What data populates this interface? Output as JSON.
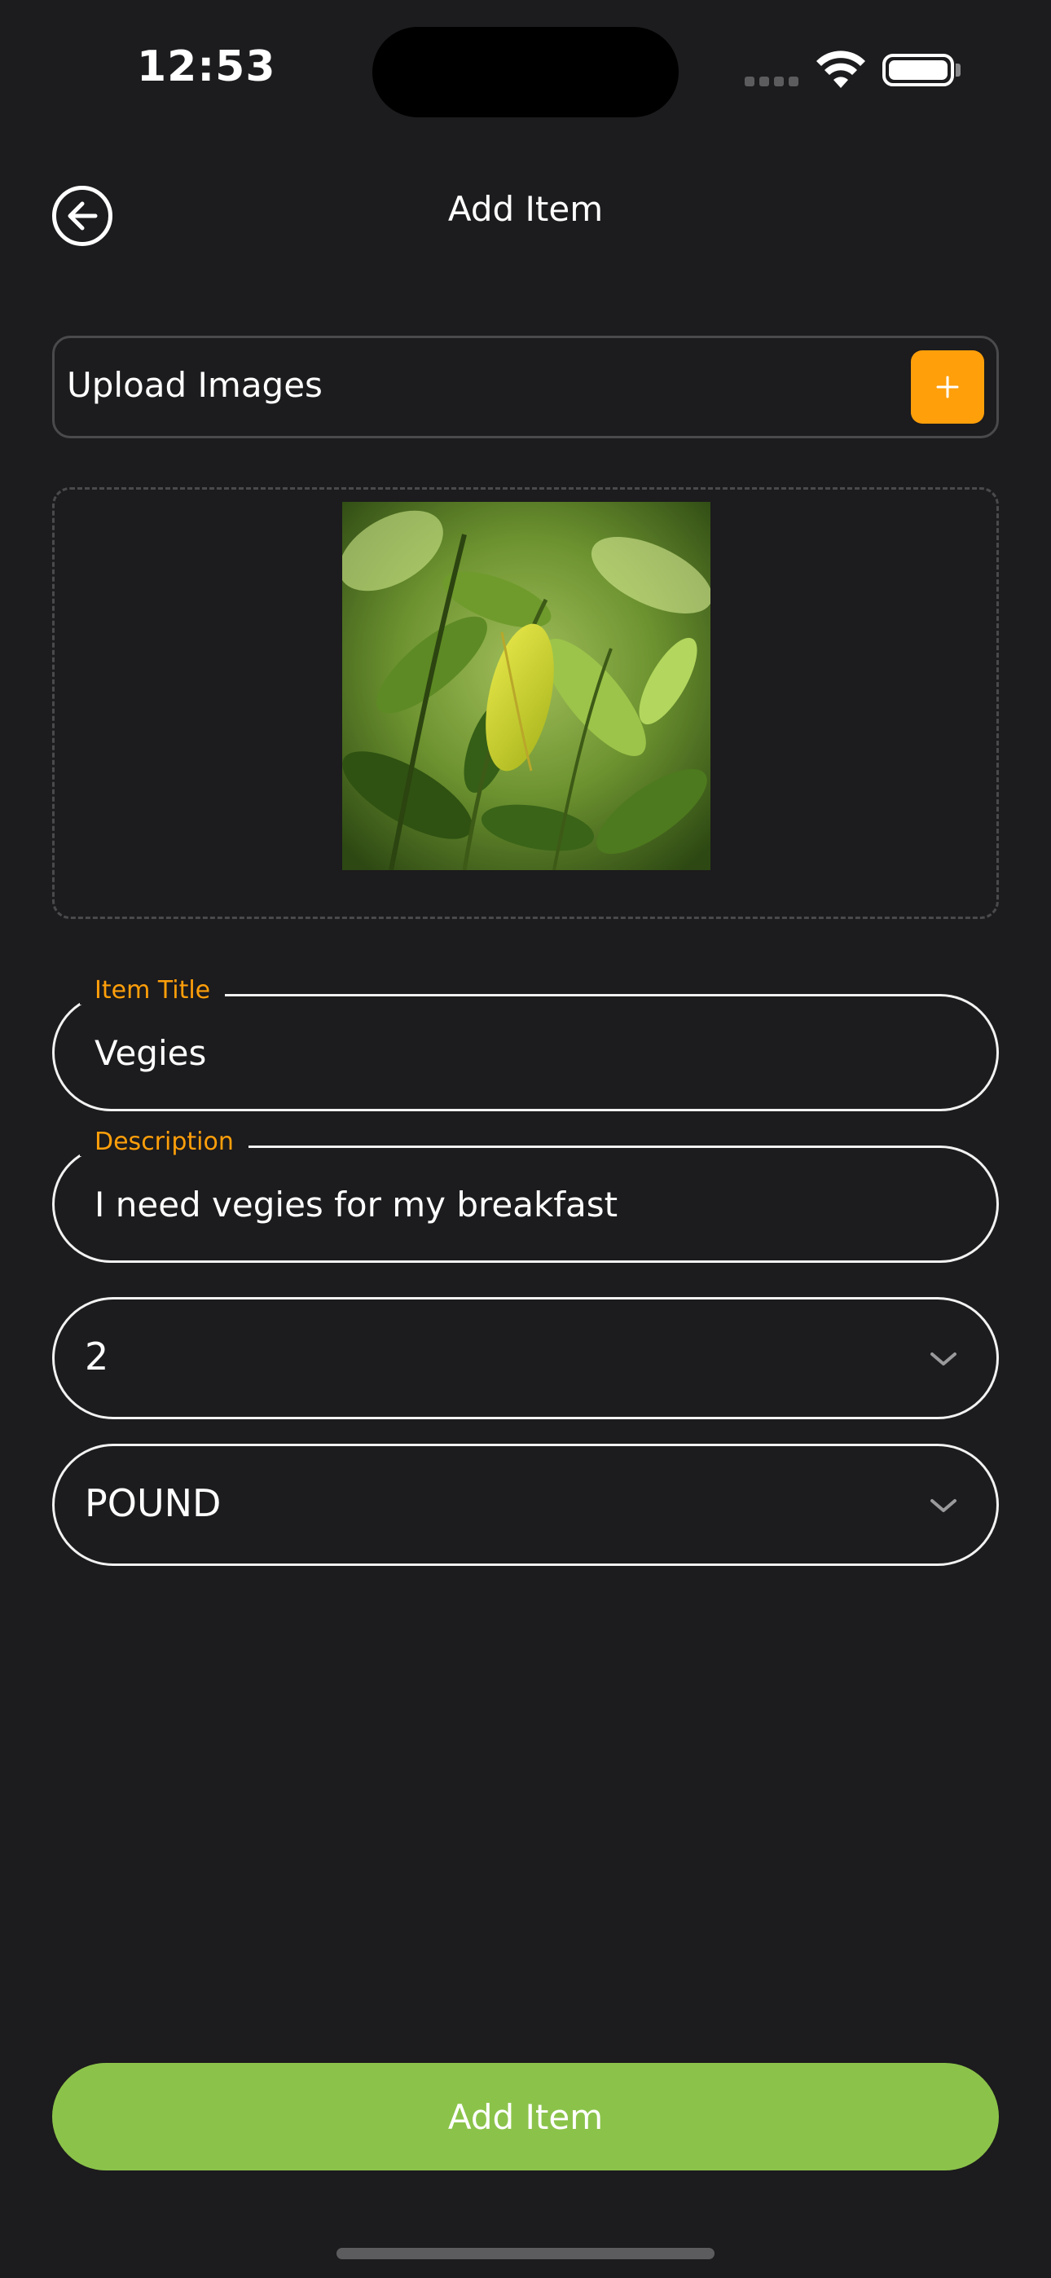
{
  "status_bar": {
    "time": "12:53"
  },
  "header": {
    "back_icon": "arrow-left-circle-icon",
    "title": "Add Item"
  },
  "upload": {
    "label": "Upload Images",
    "add_icon": "plus-icon",
    "accent_color": "#ff9f0a"
  },
  "image_preview": {
    "subject": "green leaves photo"
  },
  "fields": {
    "title": {
      "label": "Item Title",
      "value": "Vegies"
    },
    "description": {
      "label": "Description",
      "value": "I need vegies for my breakfast"
    }
  },
  "quantity_select": {
    "value": "2"
  },
  "unit_select": {
    "value": "POUND"
  },
  "submit": {
    "label": "Add Item",
    "color": "#8bc34a"
  }
}
